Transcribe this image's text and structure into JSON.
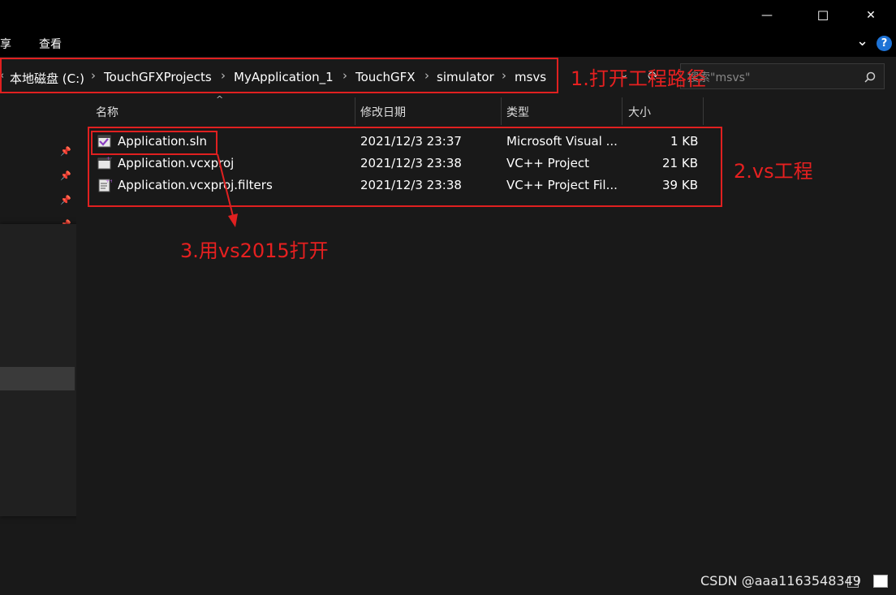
{
  "window": {
    "minimize_glyph": "—",
    "maximize_glyph": "☐",
    "close_glyph": "✕"
  },
  "ribbon": {
    "tabs": [
      {
        "label": "享"
      },
      {
        "label": "查看"
      }
    ],
    "expand_glyph": "⌄",
    "help_glyph": "?"
  },
  "address": {
    "breadcrumbs": [
      {
        "label": "本地磁盘 (C:)"
      },
      {
        "label": "TouchGFXProjects"
      },
      {
        "label": "MyApplication_1"
      },
      {
        "label": "TouchGFX"
      },
      {
        "label": "simulator"
      },
      {
        "label": "msvs"
      }
    ],
    "separator": "›"
  },
  "search": {
    "placeholder": "搜索\"msvs\""
  },
  "columns": [
    {
      "label": "名称"
    },
    {
      "label": "修改日期"
    },
    {
      "label": "类型"
    },
    {
      "label": "大小"
    }
  ],
  "files": [
    {
      "name": "Application.sln",
      "modified": "2021/12/3 23:37",
      "type": "Microsoft Visual ...",
      "size": "1 KB",
      "icon": "vs-solution-icon"
    },
    {
      "name": "Application.vcxproj",
      "modified": "2021/12/3 23:38",
      "type": "VC++ Project",
      "size": "21 KB",
      "icon": "vcxproj-icon"
    },
    {
      "name": "Application.vcxproj.filters",
      "modified": "2021/12/3 23:38",
      "type": "VC++ Project Fil...",
      "size": "39 KB",
      "icon": "filters-file-icon"
    }
  ],
  "annotations": {
    "step1": "1.打开工程路径",
    "step2": "2.vs工程",
    "step3": "3.用vs2015打开"
  },
  "watermark": "CSDN @aaa1163548349",
  "colors": {
    "annotation_red": "#e02020",
    "background": "#191919",
    "titlebar": "#000000",
    "help_blue": "#1e73d6"
  }
}
